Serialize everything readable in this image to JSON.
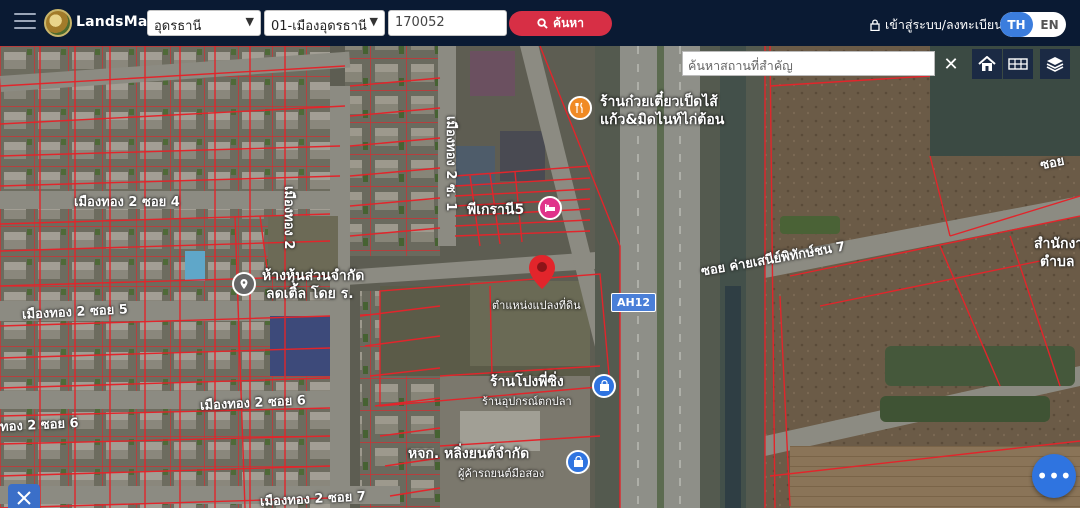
{
  "brand": {
    "name": "LandsMaps"
  },
  "search": {
    "province": "อุดรธานี",
    "district": "01-เมืองอุดรธานี",
    "parcel_no": "170052",
    "button_label": "ค้นหา"
  },
  "account": {
    "login_label": "เข้าสู่ระบบ/ลงทะเบียน"
  },
  "language": {
    "active": "TH",
    "inactive": "EN"
  },
  "map": {
    "search_placeholder": "ค้นหาสถานที่สำคัญ",
    "marker_caption": "ตำแหน่งแปลงที่ดิน",
    "highway_chip": "AH12",
    "road_labels": [
      {
        "text": "เมืองทอง 2 ซอย 4"
      },
      {
        "text": "เมืองทอง 2 ซอย 5"
      },
      {
        "text": "เมืองทอง 2 ซอย 6"
      },
      {
        "text": "เมืองทอง 2 ซอย 7"
      },
      {
        "text": "ทอง 2 ซอย 6"
      },
      {
        "text": "เมืองทอง 2"
      },
      {
        "text": "เมืองทอง 2 ซ. 1"
      },
      {
        "text": "ซอย ค่ายเสนีย์พิทักษ์ชน 7"
      },
      {
        "text": "ซอย"
      }
    ],
    "pois": [
      {
        "title": "ร้านก๋วยเตี๋ยวเป็ดไส้",
        "title2": "แก้ว&มิดไนท์ไก่ต้อน",
        "color": "#f08a24",
        "icon": "fork-knife-icon"
      },
      {
        "title": "พีเกรานี5",
        "color": "#e0338a",
        "icon": "hotel-icon"
      },
      {
        "title": "ห้างหุ้นส่วนจำกัด",
        "title2": "ลดเติ้ล โดย ร.",
        "color": "#666666",
        "icon": "location-pin-icon"
      },
      {
        "title": "ร้านโปงพี่ซิ่ง",
        "sub": "ร้านอุปกรณ์ตกปลา",
        "color": "#2f74e0",
        "icon": "shop-bag-icon"
      },
      {
        "title": "หจก. หลิ่งยนต์จำกัด",
        "sub": "ผู้ค้ารถยนต์มือสอง",
        "color": "#2f74e0",
        "icon": "shop-bag-icon"
      },
      {
        "title": "สำนักงาน",
        "title2": "ตำบล",
        "color": "#ffffff",
        "icon": ""
      }
    ]
  }
}
